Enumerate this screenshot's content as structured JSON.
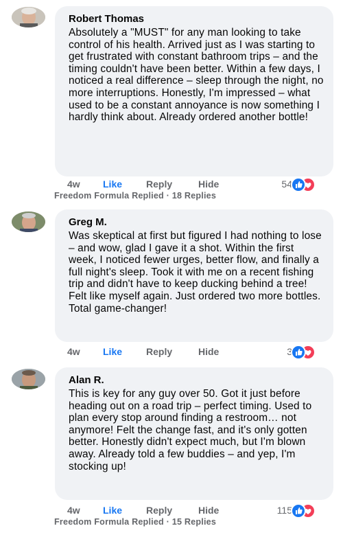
{
  "comments": [
    {
      "author": "Robert Thomas",
      "text": "Absolutely a \"MUST\" for any man looking to take control of his health. Arrived just as I was starting to get frustrated with constant bathroom trips – and the timing couldn't have been better. Within a few days, I noticed a real difference – sleep through the night, no more interruptions. Honestly, I'm impressed – what used to be a constant annoyance is now something I hardly think about. Already ordered another bottle!",
      "time": "4w",
      "like_label": "Like",
      "reply_label": "Reply",
      "hide_label": "Hide",
      "reaction_count": "54",
      "replies_label": "Freedom Formula Replied · 18 Replies",
      "reactions": [
        "like-icon",
        "love-icon"
      ]
    },
    {
      "author": "Greg M.",
      "text": "Was skeptical at first but figured I had nothing to lose – and wow, glad I gave it a shot. Within the first week, I noticed fewer urges, better flow, and finally a full night's sleep. Took it with me on a recent fishing trip and didn't have to keep ducking behind a tree! Felt like myself again. Just ordered two more bottles. Total game-changer!",
      "time": "4w",
      "like_label": "Like",
      "reply_label": "Reply",
      "hide_label": "Hide",
      "reaction_count": "3",
      "reactions": [
        "like-icon",
        "love-icon"
      ]
    },
    {
      "author": "Alan R.",
      "text": "This is key for any guy over 50. Got it just before heading out on a road trip – perfect timing. Used to plan every stop around finding a restroom… not anymore! Felt the change fast, and it's only gotten better. Honestly didn't expect much, but I'm blown away. Already told a few buddies – and yep, I'm stocking up!",
      "time": "4w",
      "like_label": "Like",
      "reply_label": "Reply",
      "hide_label": "Hide",
      "reaction_count": "115",
      "replies_label": "Freedom Formula Replied · 15 Replies",
      "reactions": [
        "like-icon",
        "love-icon"
      ]
    }
  ],
  "colors": {
    "bubble": "#f0f2f5",
    "like_blue": "#1877f2",
    "love_red": "#f33e58",
    "meta_grey": "#65676b"
  }
}
